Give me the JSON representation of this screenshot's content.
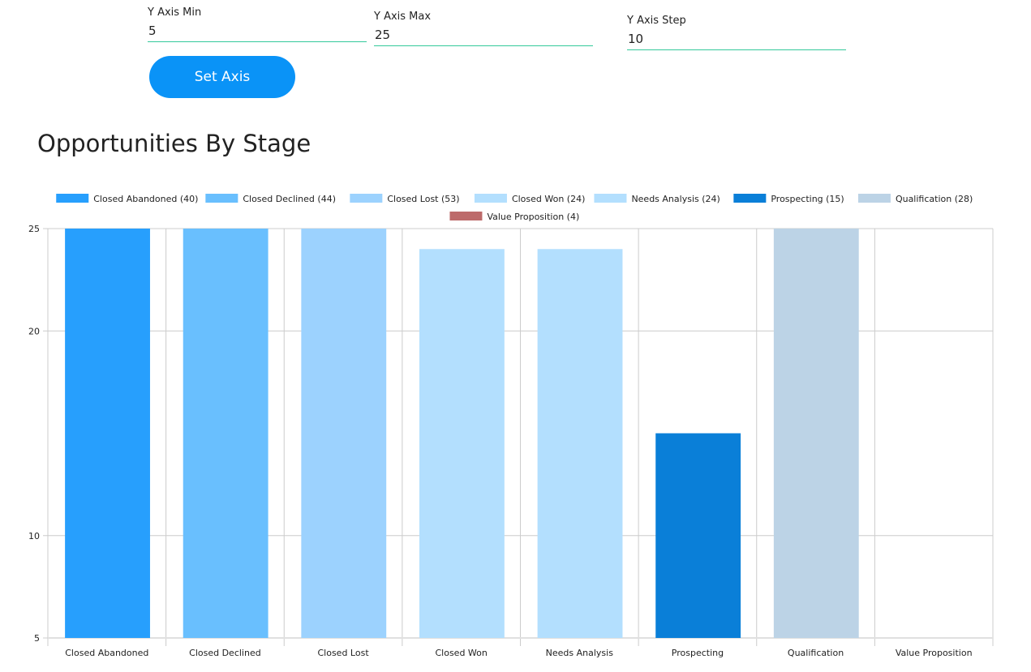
{
  "controls": {
    "y_min": {
      "label": "Y Axis Min",
      "value": "5"
    },
    "y_max": {
      "label": "Y Axis Max",
      "value": "25"
    },
    "y_step": {
      "label": "Y Axis Step",
      "value": "10"
    },
    "set_axis_label": "Set Axis"
  },
  "colors": {
    "input_underline": "#34c99b",
    "button": "#0a93f7",
    "grid": "#cccccc"
  },
  "chart_data": {
    "type": "bar",
    "title": "Opportunities By Stage",
    "xlabel": "",
    "ylabel": "",
    "ylim": [
      5,
      25
    ],
    "yticks": [
      5,
      10,
      20,
      25
    ],
    "grid": true,
    "legend_position": "top",
    "categories": [
      "Closed Abandoned",
      "Closed Declined",
      "Closed Lost",
      "Closed Won",
      "Needs Analysis",
      "Prospecting",
      "Qualification",
      "Value Proposition"
    ],
    "values": [
      40,
      44,
      53,
      24,
      24,
      15,
      28,
      4
    ],
    "colors": [
      "#279ffd",
      "#69bffe",
      "#9cd2fe",
      "#b3dffe",
      "#b3dffe",
      "#0a7fd8",
      "#bcd3e6",
      "#bd6b6b"
    ],
    "legend": [
      "Closed Abandoned (40)",
      "Closed Declined (44)",
      "Closed Lost (53)",
      "Closed Won (24)",
      "Needs Analysis (24)",
      "Prospecting (15)",
      "Qualification (28)",
      "Value Proposition (4)"
    ]
  }
}
